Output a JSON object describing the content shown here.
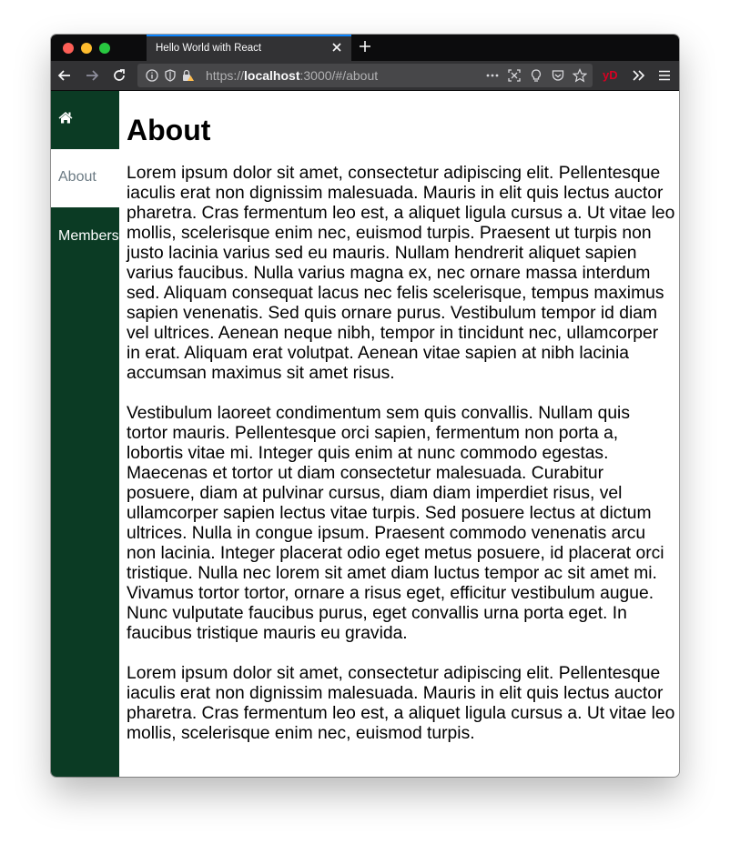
{
  "browser": {
    "tab_title": "Hello World with React",
    "url_prefix": "https://",
    "url_host": "localhost",
    "url_path": ":3000/#/about",
    "profile_badge": "yD"
  },
  "sidebar": {
    "items": [
      {
        "label": "",
        "icon": "home-icon"
      },
      {
        "label": "About"
      },
      {
        "label": "Members"
      }
    ]
  },
  "main": {
    "heading": "About",
    "paragraphs": [
      "Lorem ipsum dolor sit amet, consectetur adipiscing elit. Pellentesque iaculis erat non dignissim malesuada. Mauris in elit quis lectus auctor pharetra. Cras fermentum leo est, a aliquet ligula cursus a. Ut vitae leo mollis, scelerisque enim nec, euismod turpis. Praesent ut turpis non justo lacinia varius sed eu mauris. Nullam hendrerit aliquet sapien varius faucibus. Nulla varius magna ex, nec ornare massa interdum sed. Aliquam consequat lacus nec felis scelerisque, tempus maximus sapien venenatis. Sed quis ornare purus. Vestibulum tempor id diam vel ultrices. Aenean neque nibh, tempor in tincidunt nec, ullamcorper in erat. Aliquam erat volutpat. Aenean vitae sapien at nibh lacinia accumsan maximus sit amet risus.",
      "Vestibulum laoreet condimentum sem quis convallis. Nullam quis tortor mauris. Pellentesque orci sapien, fermentum non porta a, lobortis vitae mi. Integer quis enim at nunc commodo egestas. Maecenas et tortor ut diam consectetur malesuada. Curabitur posuere, diam at pulvinar cursus, diam diam imperdiet risus, vel ullamcorper sapien lectus vitae turpis. Sed posuere lectus at dictum ultrices. Nulla in congue ipsum. Praesent commodo venenatis arcu non lacinia. Integer placerat odio eget metus posuere, id placerat orci tristique. Nulla nec lorem sit amet diam luctus tempor ac sit amet mi. Vivamus tortor tortor, ornare a risus eget, efficitur vestibulum augue. Nunc vulputate faucibus purus, eget convallis urna porta eget. In faucibus tristique mauris eu gravida.",
      "Lorem ipsum dolor sit amet, consectetur adipiscing elit. Pellentesque iaculis erat non dignissim malesuada. Mauris in elit quis lectus auctor pharetra. Cras fermentum leo est, a aliquet ligula cursus a. Ut vitae leo mollis, scelerisque enim nec, euismod turpis."
    ]
  },
  "colors": {
    "sidebar_bg": "#0b3b24",
    "active_item_bg": "#ffffff",
    "active_item_text": "#6c7b84",
    "tab_accent": "#0a84ff"
  }
}
